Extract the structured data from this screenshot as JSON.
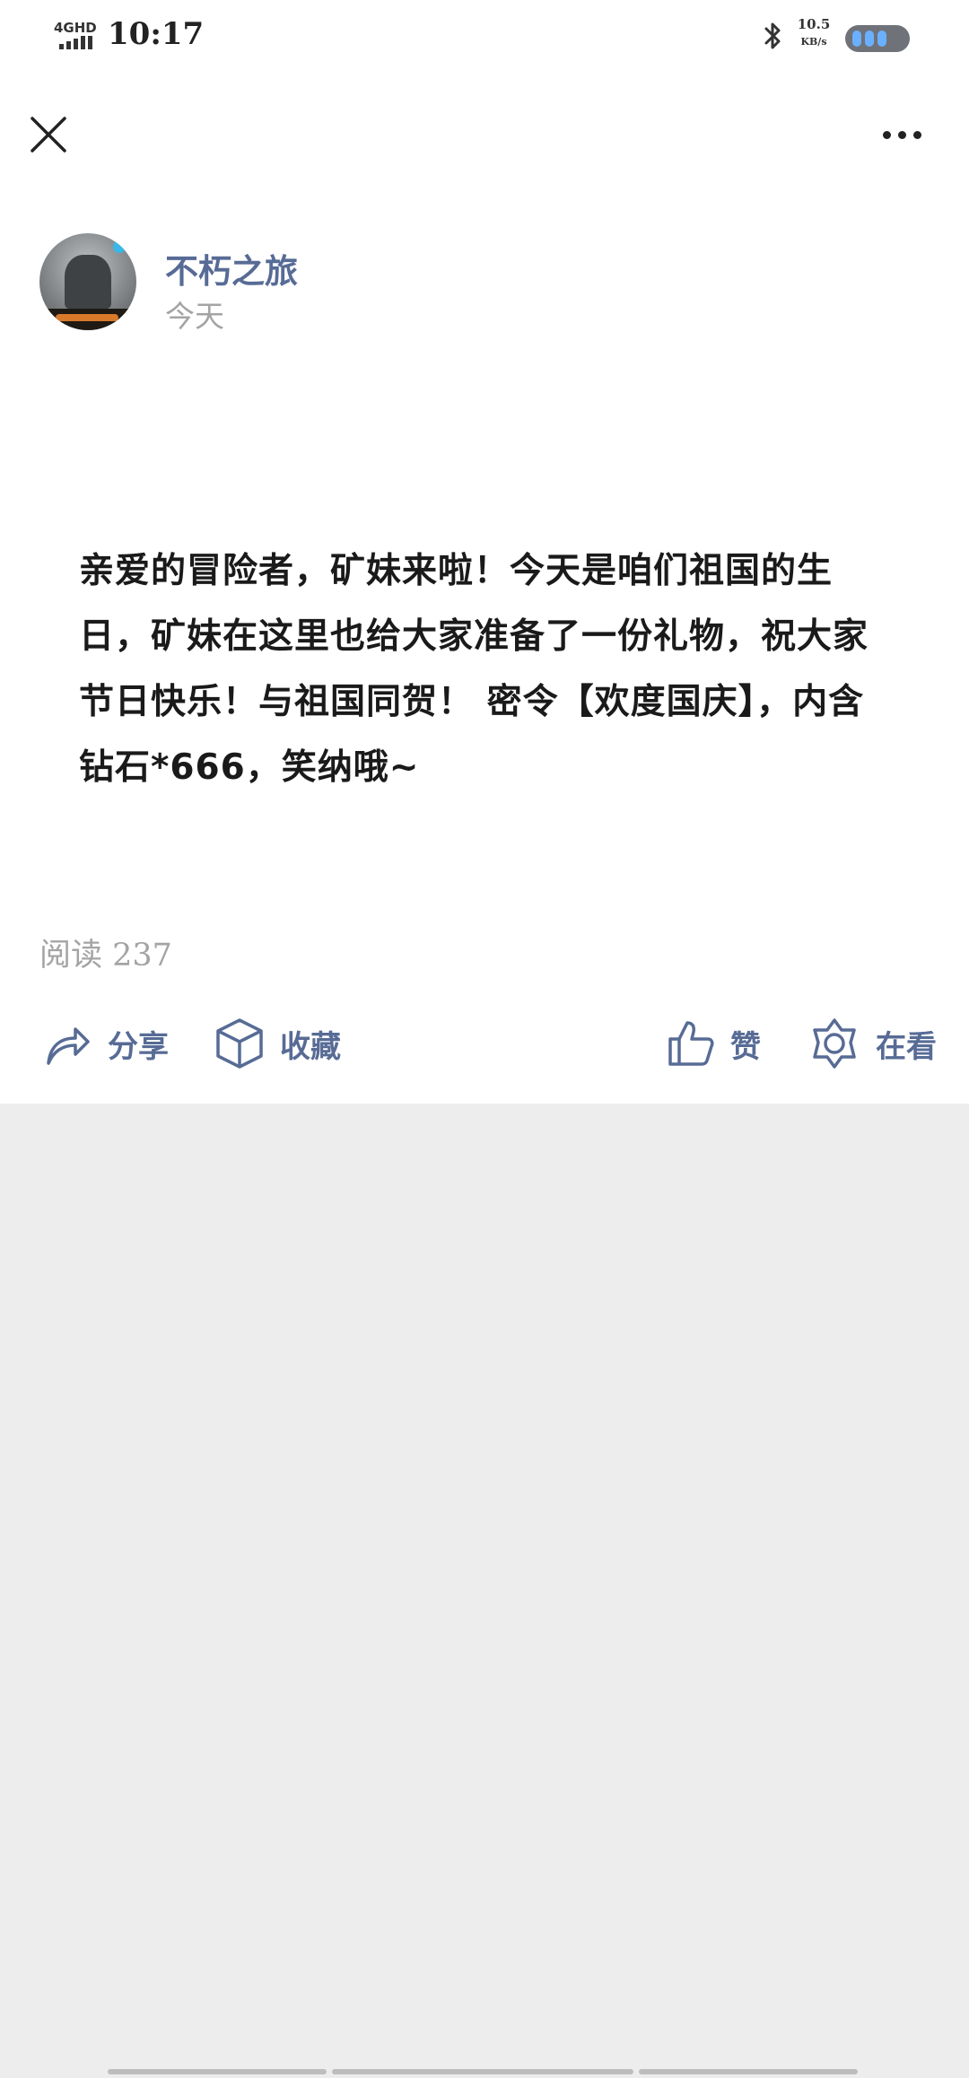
{
  "status_bar": {
    "network": "4GHD",
    "time": "10:17",
    "speed_value": "10.5",
    "speed_unit": "KB/s",
    "bluetooth_icon": "bluetooth-icon",
    "battery_icon": "battery-icon"
  },
  "nav": {
    "close_icon": "close-icon",
    "more_icon": "more-dots-icon"
  },
  "author": {
    "name": "不朽之旅",
    "date": "今天"
  },
  "article": {
    "text": "亲爱的冒险者，矿妹来啦！今天是咱们祖国的生日，矿妹在这里也给大家准备了一份礼物，祝大家节日快乐！与祖国同贺！  密令【欢度国庆】，内含钻石*666，笑纳哦~"
  },
  "stats": {
    "read_label": "阅读 237"
  },
  "actions": {
    "share": "分享",
    "favorite": "收藏",
    "like": "赞",
    "looking": "在看"
  },
  "colors": {
    "link_blue": "#576b95",
    "gray_text": "#a4a4a4",
    "page_gray": "#ededed"
  }
}
